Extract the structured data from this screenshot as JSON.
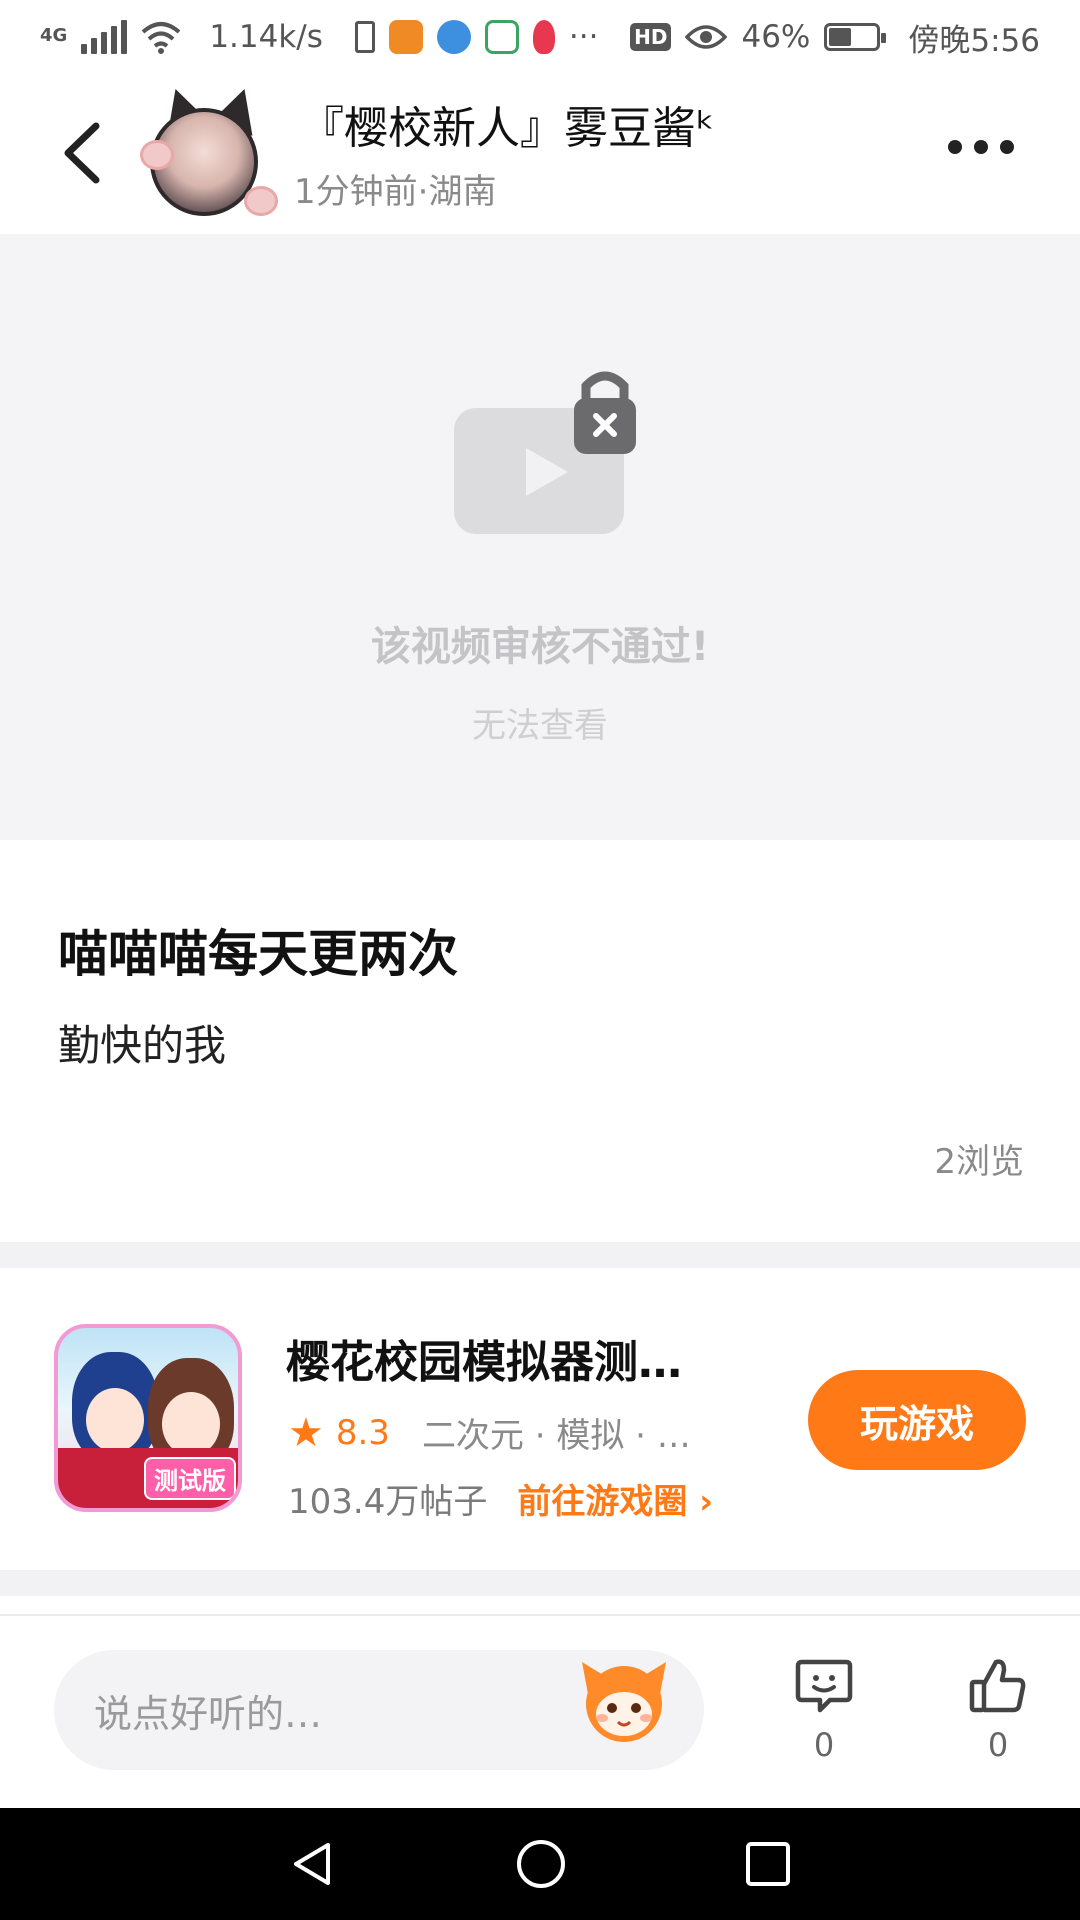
{
  "status_bar": {
    "network": "4G",
    "speed": "1.14k/s",
    "more": "···",
    "hd": "HD",
    "battery": "46%",
    "time": "傍晚5:56"
  },
  "header": {
    "username": "『樱校新人』雾豆酱ᵏ",
    "meta": "1分钟前·湖南"
  },
  "video": {
    "title": "该视频审核不通过!",
    "subtitle": "无法查看"
  },
  "post": {
    "title": "喵喵喵每天更两次",
    "body": "勤快的我",
    "views": "2浏览"
  },
  "game": {
    "icon_tag": "测试版",
    "name": "樱花校园模拟器测…",
    "rating": "8.3",
    "tags": "二次元 · 模拟 · …",
    "posts": "103.4万帖子",
    "circle_link": "前往游戏圈 ›",
    "play_label": "玩游戏",
    "accent": "#ff7a16"
  },
  "bottom": {
    "comment_placeholder": "说点好听的…",
    "comment_count": "0",
    "like_count": "0"
  }
}
